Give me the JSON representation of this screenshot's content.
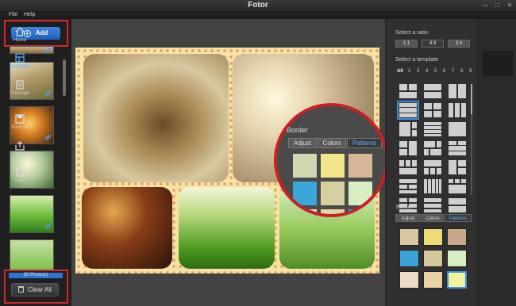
{
  "window": {
    "title": "Fotor"
  },
  "menu": [
    "File",
    "Help"
  ],
  "left": {
    "add_label": "Add",
    "photo_count": "30 Photo(s)",
    "clear_label": "Clear All"
  },
  "ratio": {
    "label": "Select a ratio",
    "options": [
      "1:1",
      "4:3",
      "3:4"
    ],
    "selected": "4:3"
  },
  "template": {
    "label": "Select a template",
    "numbers": [
      "All",
      "2",
      "3",
      "4",
      "5",
      "6",
      "7",
      "8",
      "9"
    ]
  },
  "border": {
    "label": "Border",
    "tabs": [
      "Adjust",
      "Colors",
      "Patterns"
    ],
    "active_tab": "Patterns"
  },
  "magnifier": {
    "label": "Border",
    "tabs": [
      "Adjust",
      "Colors",
      "Patterns"
    ]
  },
  "nav": [
    "Home",
    "Templates",
    "Freestyle",
    "Save as",
    "Share",
    "New"
  ],
  "colors": {
    "accent": "#2e73cf",
    "highlight": "#d9262e",
    "active_tab": "#3a8fe6"
  }
}
